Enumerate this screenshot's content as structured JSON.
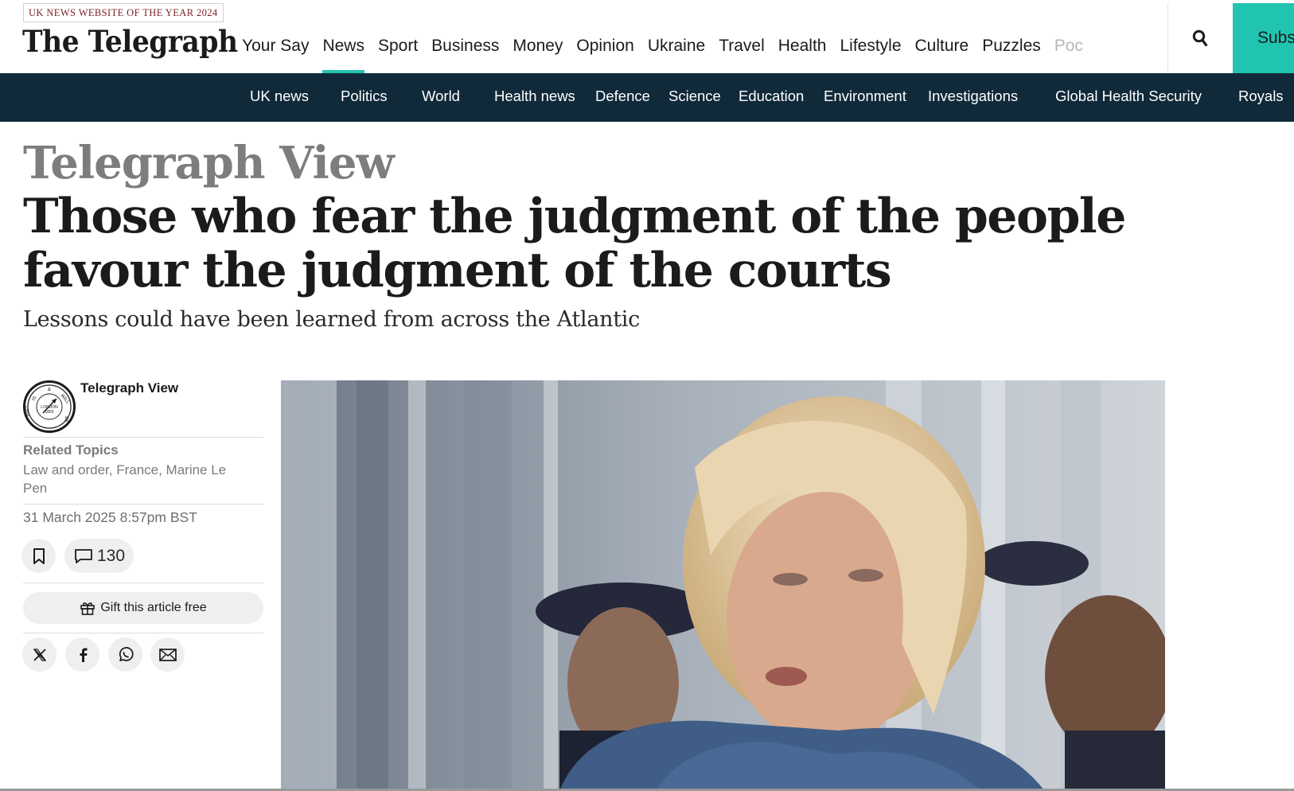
{
  "header": {
    "award": "UK NEWS WEBSITE OF THE YEAR 2024",
    "logo": "The Telegraph",
    "nav": [
      "Your Say",
      "News",
      "Sport",
      "Business",
      "Money",
      "Opinion",
      "Ukraine",
      "Travel",
      "Health",
      "Lifestyle",
      "Culture",
      "Puzzles",
      "Poc"
    ],
    "active_nav": "News",
    "subscribe_label": "Subs",
    "search_icon": "search-icon"
  },
  "subnav": [
    "UK news",
    "Politics",
    "World",
    "Health news",
    "Defence",
    "Science",
    "Education",
    "Environment",
    "Investigations",
    "Global Health Security",
    "Royals"
  ],
  "article": {
    "kicker": "Telegraph View",
    "headline": "Those who fear the judgment of the people favour the judgment of the courts",
    "standfirst": "Lessons could have been learned from across the Atlantic",
    "author": "Telegraph View",
    "related_label": "Related Topics",
    "related_topics": "Law and order, France, Marine Le Pen",
    "date": "31 March 2025 8:57pm BST",
    "comment_count": "130",
    "gift_label": "Gift this article free",
    "share_icons": [
      "x-icon",
      "facebook-icon",
      "whatsapp-icon",
      "email-icon"
    ]
  },
  "colors": {
    "accent": "#21c4b0",
    "subnav_bg": "#102a3a",
    "award_text": "#7a1f22"
  }
}
